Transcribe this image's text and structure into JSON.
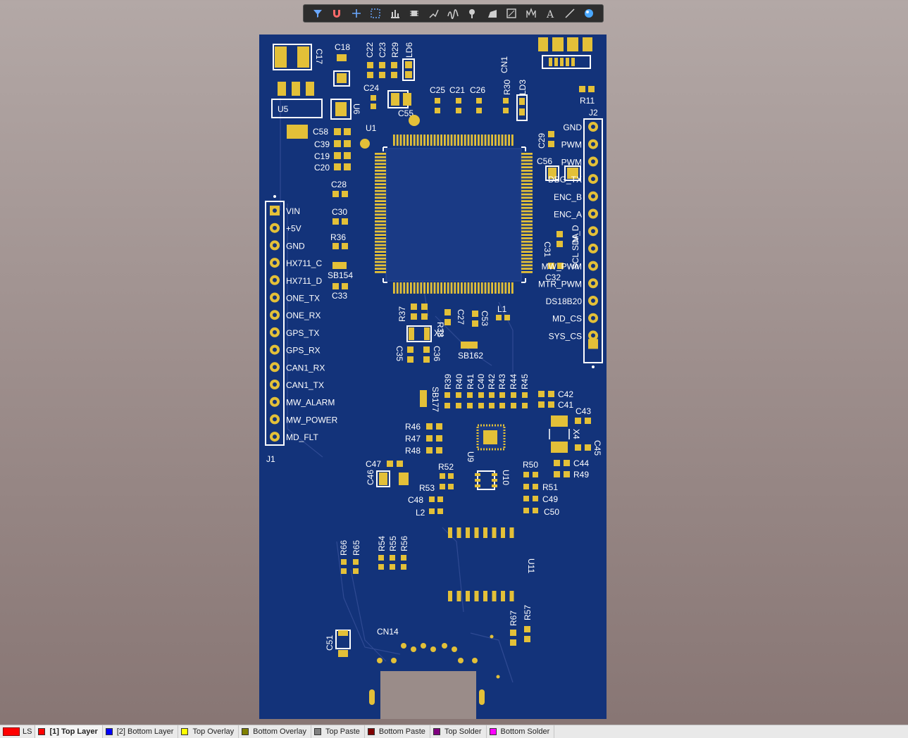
{
  "toolbar": {
    "tools": [
      "filter-icon",
      "snap-magnet-icon",
      "crosshair-add-icon",
      "select-rect-icon",
      "align-icon",
      "component-icon",
      "route-icon",
      "interactive-route-icon",
      "via-icon",
      "polygon-icon",
      "fill-icon",
      "diff-pair-icon",
      "text-icon",
      "line-icon",
      "3d-view-icon"
    ]
  },
  "board": {
    "color": "#13337a",
    "components": {
      "C17": "C17",
      "C18": "C18",
      "C22": "C22",
      "C23": "C23",
      "R29": "R29",
      "LD6": "LD6",
      "CN1": "CN1",
      "C24": "C24",
      "C25": "C25",
      "C21": "C21",
      "C26": "C26",
      "R30": "R30",
      "LD3": "LD3",
      "R11": "R11",
      "J2": "J2",
      "U5": "U5",
      "U6": "U6",
      "C55": "C55",
      "U1": "U1",
      "C58": "C58",
      "C39": "C39",
      "C19": "C19",
      "C20": "C20",
      "C29": "C29",
      "C56": "C56",
      "C28": "C28",
      "C30": "C30",
      "R36": "R36",
      "SB154": "SB154",
      "C33": "C33",
      "C31": "C31",
      "C32": "C32",
      "R37": "R37",
      "R38": "R38",
      "C27": "C27",
      "C53": "C53",
      "L1": "L1",
      "X2": "X2",
      "C35": "C35",
      "C36": "C36",
      "SB162": "SB162",
      "SB177": "SB177",
      "R39": "R39",
      "R40": "R40",
      "R41": "R41",
      "C40": "C40",
      "R42": "R42",
      "R43": "R43",
      "R44": "R44",
      "R45": "R45",
      "C42": "C42",
      "C41": "C41",
      "C43": "C43",
      "X4": "X4",
      "C45": "C45",
      "R46": "R46",
      "R47": "R47",
      "R48": "R48",
      "U9": "U9",
      "C44": "C44",
      "R49": "R49",
      "C47": "C47",
      "C46": "C46",
      "R52": "R52",
      "U10": "U10",
      "R50": "R50",
      "R53": "R53",
      "R51": "R51",
      "C48": "C48",
      "C49": "C49",
      "L2": "L2",
      "C50": "C50",
      "R66": "R66",
      "R65": "R65",
      "R54": "R54",
      "R55": "R55",
      "R56": "R56",
      "U11": "U11",
      "R67": "R67",
      "R57": "R57",
      "C51": "C51",
      "CN14": "CN14",
      "J1": "J1"
    },
    "j1_pins": [
      "VIN",
      "+5V",
      "GND",
      "HX711_C",
      "HX711_D",
      "ONE_TX",
      "ONE_RX",
      "GPS_TX",
      "GPS_RX",
      "CAN1_RX",
      "CAN1_TX",
      "MW_ALARM",
      "MW_POWER",
      "MD_FLT"
    ],
    "j2_pins": [
      "GND",
      "PWM",
      "PWM",
      "DBG_TX",
      "ENC_B",
      "ENC_A",
      "M_D",
      "SCL SDA",
      "MW_PWM",
      "MTR_PWM",
      "DS18B20",
      "MD_CS",
      "SYS_CS"
    ]
  },
  "layers": {
    "ls_label": "LS",
    "tabs": [
      {
        "label": "[1] Top Layer",
        "color": "#ff0000",
        "active": true
      },
      {
        "label": "[2] Bottom Layer",
        "color": "#0000ff",
        "active": false
      },
      {
        "label": "Top Overlay",
        "color": "#ffff00",
        "active": false
      },
      {
        "label": "Bottom Overlay",
        "color": "#808000",
        "active": false
      },
      {
        "label": "Top Paste",
        "color": "#808080",
        "active": false
      },
      {
        "label": "Bottom Paste",
        "color": "#800000",
        "active": false
      },
      {
        "label": "Top Solder",
        "color": "#800080",
        "active": false
      },
      {
        "label": "Bottom Solder",
        "color": "#ff00ff",
        "active": false
      }
    ]
  }
}
